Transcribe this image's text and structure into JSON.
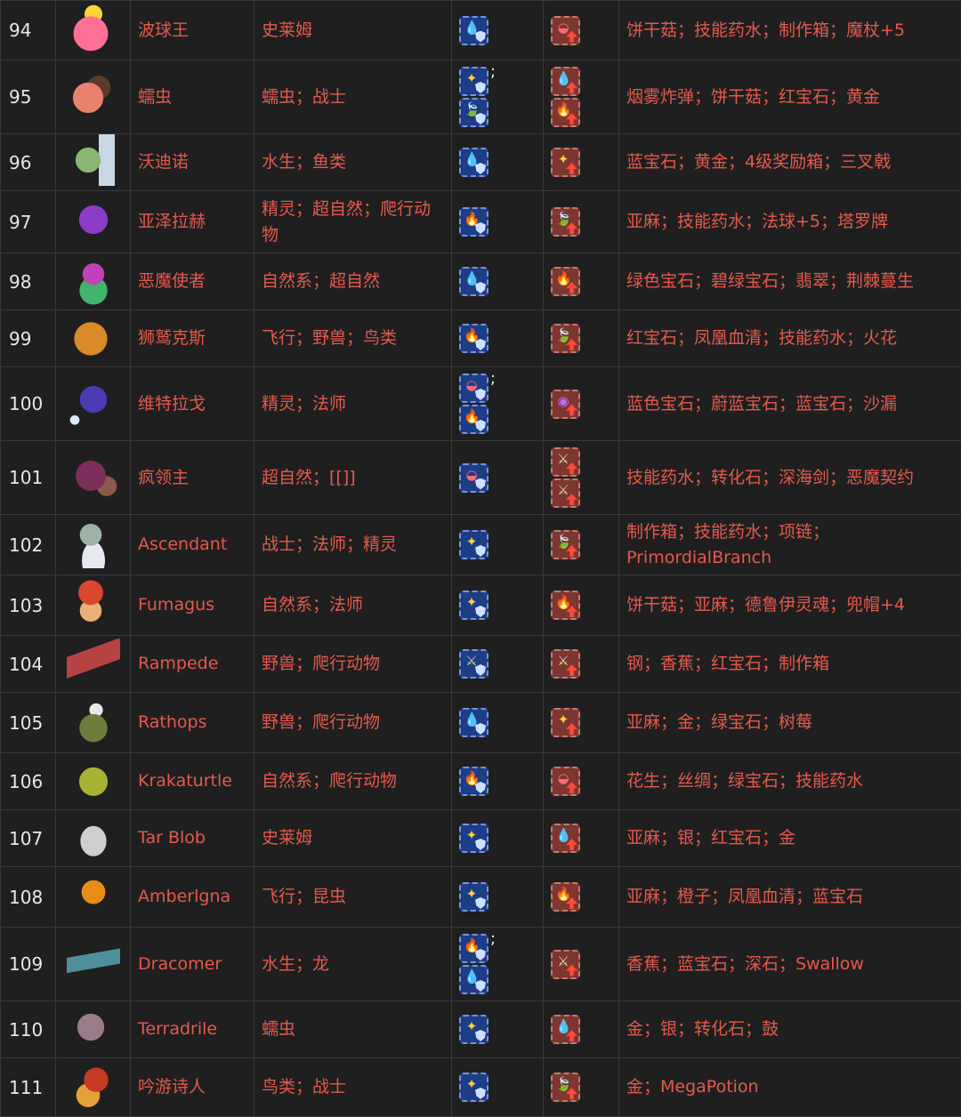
{
  "colors": {
    "background": "#1f1f1f",
    "border": "#3a3a3a",
    "link_text": "#e55a4c",
    "number_text": "#e8e8e8",
    "resist_badge": "#1d3d86",
    "weak_badge": "#7c3730"
  },
  "element_glyphs": {
    "water": "💧",
    "fire": "🔥",
    "light": "✦",
    "nature": "🍃",
    "blood": "◒",
    "arcane": "◉",
    "physical": "⚔"
  },
  "rows": [
    {
      "num": "94",
      "sprite": "pink-slime-king",
      "name": "波球王",
      "type": "史莱姆",
      "resist": [
        "water"
      ],
      "weak": [
        "blood"
      ],
      "drops": "饼干菇；技能药水；制作箱；魔杖+5"
    },
    {
      "num": "95",
      "sprite": "worm-creature",
      "name": "蠕虫",
      "type": "蠕虫；战士",
      "resist": [
        "light",
        "nature"
      ],
      "weak": [
        "water",
        "fire"
      ],
      "drops": "烟雾炸弹；饼干菇；红宝石；黄金"
    },
    {
      "num": "96",
      "sprite": "fishman-warrior",
      "name": "沃迪诺",
      "type": "水生；鱼类",
      "resist": [
        "water"
      ],
      "weak": [
        "light"
      ],
      "drops": "蓝宝石；黄金；4级奖励箱；三叉戟"
    },
    {
      "num": "97",
      "sprite": "purple-elf",
      "name": "亚泽拉赫",
      "type": "精灵；超自然；爬行动物",
      "resist": [
        "fire"
      ],
      "weak": [
        "nature"
      ],
      "drops": "亚麻；技能药水；法球+5；塔罗牌"
    },
    {
      "num": "98",
      "sprite": "demon-plant",
      "name": "恶魔使者",
      "type": "自然系；超自然",
      "resist": [
        "water"
      ],
      "weak": [
        "fire"
      ],
      "drops": "绿色宝石；碧绿宝石；翡翠；荆棘蔓生"
    },
    {
      "num": "99",
      "sprite": "griffin",
      "name": "狮鹫克斯",
      "type": "飞行；野兽；鸟类",
      "resist": [
        "fire"
      ],
      "weak": [
        "nature"
      ],
      "drops": "红宝石；凤凰血清；技能药水；火花"
    },
    {
      "num": "100",
      "sprite": "shadow-mage",
      "name": "维特拉戈",
      "type": "精灵；法师",
      "resist": [
        "blood",
        "fire"
      ],
      "weak": [
        "arcane"
      ],
      "drops": "蓝色宝石；蔚蓝宝石；蓝宝石；沙漏"
    },
    {
      "num": "101",
      "sprite": "mad-lord",
      "name": "疯领主",
      "type": "超自然；[[]]",
      "resist": [
        "blood"
      ],
      "weak": [
        "physical",
        "physical"
      ],
      "drops": "技能药水；转化石；深海剑；恶魔契约"
    },
    {
      "num": "102",
      "sprite": "ascendant-zombie",
      "name": "Ascendant",
      "type": "战士；法师；精灵",
      "resist": [
        "light"
      ],
      "weak": [
        "nature"
      ],
      "drops": "制作箱；技能药水；项链；PrimordialBranch"
    },
    {
      "num": "103",
      "sprite": "mushroom-kid",
      "name": "Fumagus",
      "type": "自然系；法师",
      "resist": [
        "light"
      ],
      "weak": [
        "fire"
      ],
      "drops": "饼干菇；亚麻；德鲁伊灵魂；兜帽+4"
    },
    {
      "num": "104",
      "sprite": "centipede",
      "name": "Rampede",
      "type": "野兽；爬行动物",
      "resist": [
        "physical"
      ],
      "weak": [
        "physical"
      ],
      "drops": "钢；香蕉；红宝石；制作箱"
    },
    {
      "num": "105",
      "sprite": "turtle-rider",
      "name": "Rathops",
      "type": "野兽；爬行动物",
      "resist": [
        "water"
      ],
      "weak": [
        "light"
      ],
      "drops": "亚麻；金；绿宝石；树莓"
    },
    {
      "num": "106",
      "sprite": "spiky-turtle",
      "name": "Krakaturtle",
      "type": "自然系；爬行动物",
      "resist": [
        "fire"
      ],
      "weak": [
        "blood"
      ],
      "drops": "花生；丝绸；绿宝石；技能药水"
    },
    {
      "num": "107",
      "sprite": "tar-skeleton",
      "name": "Tar Blob",
      "type": "史莱姆",
      "resist": [
        "light"
      ],
      "weak": [
        "water"
      ],
      "drops": "亚麻；银；红宝石；金"
    },
    {
      "num": "108",
      "sprite": "amber-wasp",
      "name": "Amberlgna",
      "type": "飞行；昆虫",
      "resist": [
        "light"
      ],
      "weak": [
        "fire"
      ],
      "drops": "亚麻；橙子；凤凰血清；蓝宝石"
    },
    {
      "num": "109",
      "sprite": "sea-dragon",
      "name": "Dracomer",
      "type": "水生；龙",
      "resist": [
        "fire",
        "water"
      ],
      "weak": [
        "physical"
      ],
      "drops": "香蕉；蓝宝石；深石；Swallow"
    },
    {
      "num": "110",
      "sprite": "sand-worm",
      "name": "Terradrile",
      "type": "蠕虫",
      "resist": [
        "light"
      ],
      "weak": [
        "water"
      ],
      "drops": "金；银；转化石；鼓"
    },
    {
      "num": "111",
      "sprite": "bard-bird",
      "name": "吟游诗人",
      "type": "鸟类；战士",
      "resist": [
        "light"
      ],
      "weak": [
        "nature"
      ],
      "drops": "金；MegaPotion"
    }
  ]
}
